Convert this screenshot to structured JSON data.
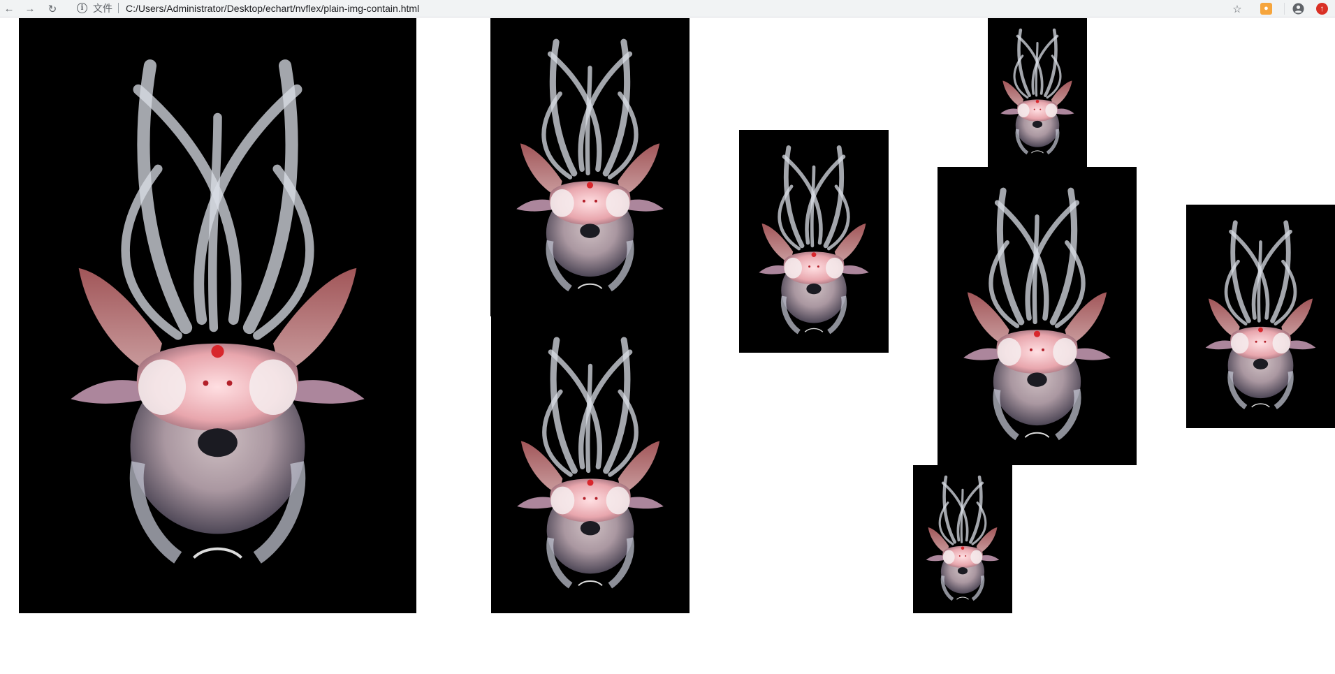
{
  "browser": {
    "back_icon": "arrow-left-icon",
    "forward_icon": "arrow-right-icon",
    "reload_icon": "reload-icon",
    "page_info_icon": "info-icon",
    "scheme_label": "文件",
    "url": "C:/Users/Administrator/Desktop/echart/nvflex/plain-img-contain.html",
    "bookmark_icon": "star-icon",
    "extension_icon": "extension-icon",
    "profile_icon": "account-icon",
    "menu_icon": "update-icon"
  },
  "gallery": {
    "image_subject": "transparent squid photograph",
    "image_count": 8,
    "colors": {
      "background": "#000000",
      "page": "#ffffff"
    }
  }
}
